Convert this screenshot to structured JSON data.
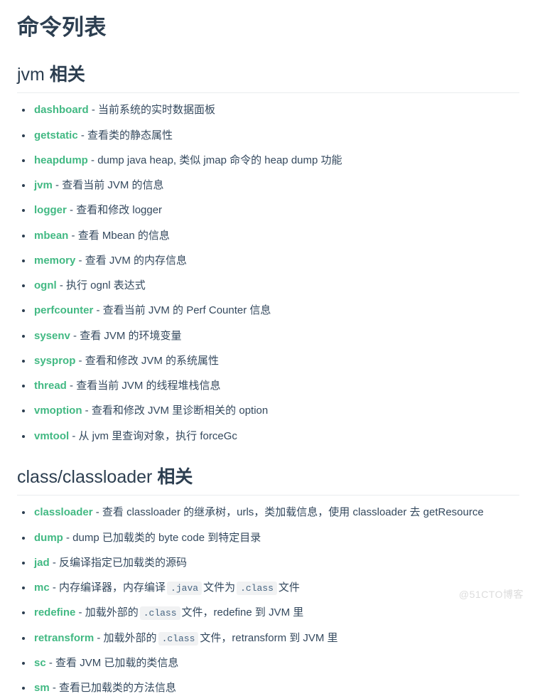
{
  "document": {
    "title": "命令列表",
    "separator": "-",
    "watermark": "@51CTO博客"
  },
  "sections": [
    {
      "heading_latin": "jvm",
      "heading_cn": "相关",
      "items": [
        {
          "name": "dashboard",
          "desc_parts": [
            {
              "type": "text",
              "value": "当前系统的实时数据面板"
            }
          ]
        },
        {
          "name": "getstatic",
          "desc_parts": [
            {
              "type": "text",
              "value": "查看类的静态属性"
            }
          ]
        },
        {
          "name": "heapdump",
          "desc_parts": [
            {
              "type": "text",
              "value": "dump java heap, 类似 jmap 命令的 heap dump 功能"
            }
          ]
        },
        {
          "name": "jvm",
          "desc_parts": [
            {
              "type": "text",
              "value": "查看当前 JVM 的信息"
            }
          ]
        },
        {
          "name": "logger",
          "desc_parts": [
            {
              "type": "text",
              "value": "查看和修改 logger"
            }
          ]
        },
        {
          "name": "mbean",
          "desc_parts": [
            {
              "type": "text",
              "value": "查看 Mbean 的信息"
            }
          ]
        },
        {
          "name": "memory",
          "desc_parts": [
            {
              "type": "text",
              "value": "查看 JVM 的内存信息"
            }
          ]
        },
        {
          "name": "ognl",
          "desc_parts": [
            {
              "type": "text",
              "value": "执行 ognl 表达式"
            }
          ]
        },
        {
          "name": "perfcounter",
          "desc_parts": [
            {
              "type": "text",
              "value": "查看当前 JVM 的 Perf Counter 信息"
            }
          ]
        },
        {
          "name": "sysenv",
          "desc_parts": [
            {
              "type": "text",
              "value": "查看 JVM 的环境变量"
            }
          ]
        },
        {
          "name": "sysprop",
          "desc_parts": [
            {
              "type": "text",
              "value": "查看和修改 JVM 的系统属性"
            }
          ]
        },
        {
          "name": "thread",
          "desc_parts": [
            {
              "type": "text",
              "value": "查看当前 JVM 的线程堆栈信息"
            }
          ]
        },
        {
          "name": "vmoption",
          "desc_parts": [
            {
              "type": "text",
              "value": "查看和修改 JVM 里诊断相关的 option"
            }
          ]
        },
        {
          "name": "vmtool",
          "desc_parts": [
            {
              "type": "text",
              "value": "从 jvm 里查询对象，执行 forceGc"
            }
          ]
        }
      ]
    },
    {
      "heading_latin": "class/classloader",
      "heading_cn": "相关",
      "items": [
        {
          "name": "classloader",
          "desc_parts": [
            {
              "type": "text",
              "value": "查看 classloader 的继承树，urls，类加载信息，使用 classloader 去 getResource"
            }
          ]
        },
        {
          "name": "dump",
          "desc_parts": [
            {
              "type": "text",
              "value": "dump 已加载类的 byte code 到特定目录"
            }
          ]
        },
        {
          "name": "jad",
          "desc_parts": [
            {
              "type": "text",
              "value": "反编译指定已加载类的源码"
            }
          ]
        },
        {
          "name": "mc",
          "desc_parts": [
            {
              "type": "text",
              "value": "内存编译器，内存编译"
            },
            {
              "type": "code",
              "value": ".java"
            },
            {
              "type": "text",
              "value": "文件为"
            },
            {
              "type": "code",
              "value": ".class"
            },
            {
              "type": "text",
              "value": "文件"
            }
          ]
        },
        {
          "name": "redefine",
          "desc_parts": [
            {
              "type": "text",
              "value": "加载外部的"
            },
            {
              "type": "code",
              "value": ".class"
            },
            {
              "type": "text",
              "value": "文件，redefine 到 JVM 里"
            }
          ]
        },
        {
          "name": "retransform",
          "desc_parts": [
            {
              "type": "text",
              "value": "加载外部的"
            },
            {
              "type": "code",
              "value": ".class"
            },
            {
              "type": "text",
              "value": "文件，retransform 到 JVM 里"
            }
          ]
        },
        {
          "name": "sc",
          "desc_parts": [
            {
              "type": "text",
              "value": "查看 JVM 已加载的类信息"
            }
          ]
        },
        {
          "name": "sm",
          "desc_parts": [
            {
              "type": "text",
              "value": "查看已加载类的方法信息"
            }
          ]
        }
      ]
    }
  ],
  "colors": {
    "link": "#42b983",
    "heading": "#2c3e50",
    "body": "#34495e",
    "code_bg": "#f1f2f3",
    "code_fg": "#476582",
    "rule": "#eaecef",
    "watermark": "#dcdcdc"
  }
}
